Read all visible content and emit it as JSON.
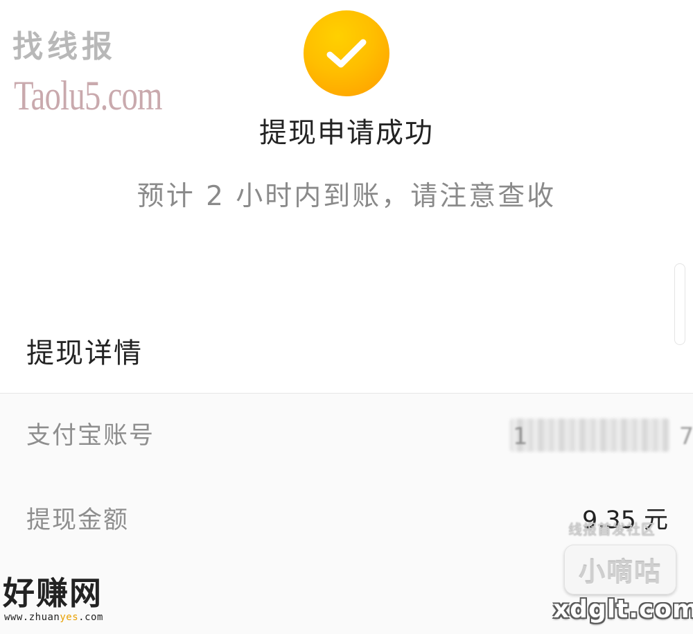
{
  "watermarks": {
    "top_left_cn": "找线报",
    "top_left_en": "Taolu5.com",
    "bottom_left_cn": "好赚网",
    "bottom_left_url_prefix": "www.zhuan",
    "bottom_left_url_accent": "yes",
    "bottom_left_url_suffix": ".com",
    "bottom_right_community": "线报首发社区",
    "bottom_right_name": "小嘀咕",
    "bottom_right_domain": "xdglt.com"
  },
  "success": {
    "icon": "checkmark-icon",
    "title": "提现申请成功",
    "subtitle": "预计 2 小时内到账，请注意查收"
  },
  "details": {
    "heading": "提现详情",
    "rows": [
      {
        "label": "支付宝账号",
        "value": "",
        "masked": true
      },
      {
        "label": "提现金额",
        "value": "9.35 元"
      }
    ]
  },
  "colors": {
    "success_gradient_start": "#ffd000",
    "success_gradient_end": "#ff9a00",
    "text_primary": "#222222",
    "text_secondary": "#8a8a8a"
  }
}
